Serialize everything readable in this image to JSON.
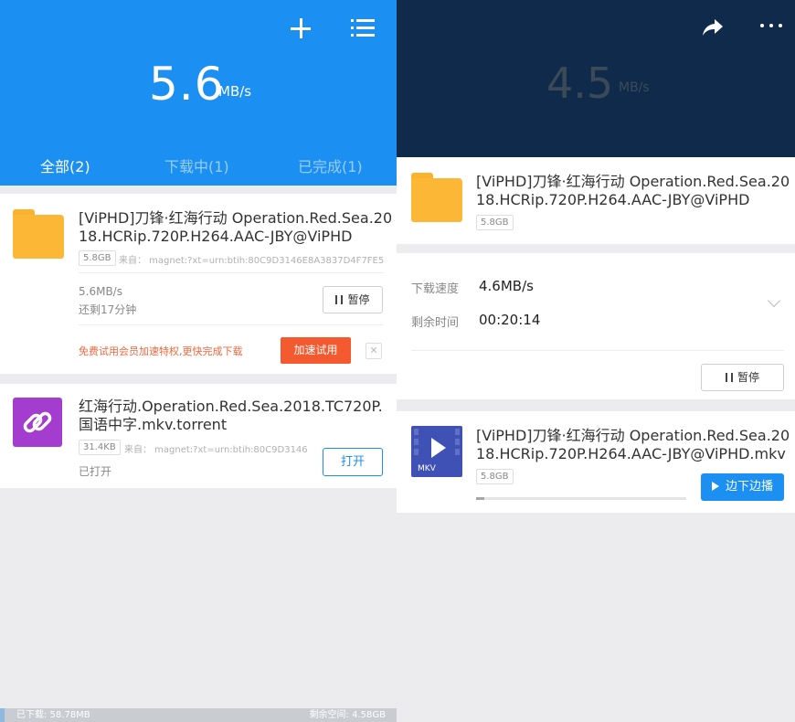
{
  "left": {
    "header": {
      "add_icon": "plus-icon",
      "menu_icon": "list-icon",
      "speed_value": "5.6",
      "speed_unit": "MB/s",
      "tabs": [
        {
          "label": "全部(2)",
          "active": true
        },
        {
          "label": "下载中(1)",
          "active": false
        },
        {
          "label": "已完成(1)",
          "active": false
        }
      ]
    },
    "task1": {
      "title_line1": "[ViPHD]刀锋·红海行动 Operation.Red.Sea.20",
      "title_line2": "18.HCRip.720P.H264.AAC-JBY@ViPHD",
      "size": "5.8GB",
      "source": "来自：  magnet:?xt=urn:btih:80C9D3146E8A3837D4F7FE5...",
      "speed": "5.6MB/s",
      "remaining": "还剩17分钟",
      "pause_label": "暂停",
      "promo_text": "免费试用会员加速特权,更快完成下载",
      "accel_label": "加速试用",
      "close_label": "✕"
    },
    "task2": {
      "title_line1": "红海行动.Operation.Red.Sea.2018.TC720P.",
      "title_line2": "国语中字.mkv.torrent",
      "size": "31.4KB",
      "source": "来自：  magnet:?xt=urn:btih:80C9D3146...",
      "status": "已打开",
      "open_label": "打开"
    },
    "footer": {
      "downloaded": "已下载: 58.78MB",
      "free_space": "剩余空间: 4.58GB",
      "storage_used_fraction": 0.012
    }
  },
  "right": {
    "header": {
      "speed_value": "4.5",
      "speed_unit": "MB/s",
      "share_icon": "share-icon",
      "more_icon": "more-icon"
    },
    "task": {
      "title_line1": "[ViPHD]刀锋·红海行动 Operation.Red.Sea.20",
      "title_line2": "18.HCRip.720P.H264.AAC-JBY@ViPHD",
      "size": "5.8GB"
    },
    "details": {
      "speed_label": "下载速度",
      "speed_value": "4.6MB/s",
      "time_label": "剩余时间",
      "time_value": "00:20:14",
      "pause_label": "暂停"
    },
    "file": {
      "title_line1": "[ViPHD]刀锋·红海行动 Operation.Red.Sea.20",
      "title_line2": "18.HCRip.720P.H264.AAC-JBY@ViPHD.mkv",
      "size": "5.8GB",
      "icon_label": "MKV",
      "play_label": "边下边播",
      "progress_fraction": 0.04
    }
  }
}
